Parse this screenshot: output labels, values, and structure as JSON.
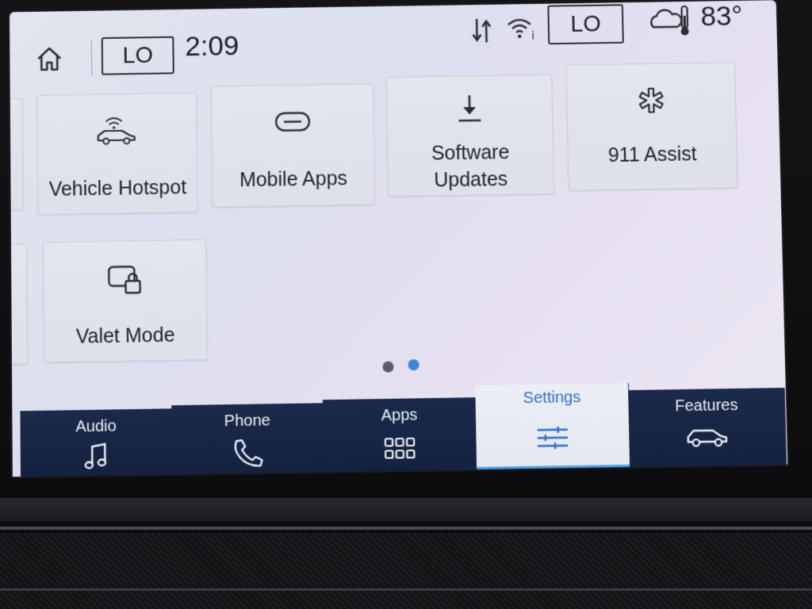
{
  "status_bar": {
    "climate_left": "LO",
    "time": "2:09",
    "climate_right": "LO",
    "temperature": "83°"
  },
  "tiles": {
    "hotspot": "Vehicle Hotspot",
    "mobile_apps": "Mobile Apps",
    "software_updates_line1": "Software",
    "software_updates_line2": "Updates",
    "assist": "911 Assist",
    "valet": "Valet Mode"
  },
  "pagination": {
    "current": 2,
    "total": 2
  },
  "nav": {
    "audio": "Audio",
    "phone": "Phone",
    "apps": "Apps",
    "settings": "Settings",
    "features": "Features",
    "active": "Settings"
  },
  "colors": {
    "accent": "#3d86dd",
    "nav_background": "#1b2a4a",
    "active_tab_text": "#2e6fc9"
  }
}
